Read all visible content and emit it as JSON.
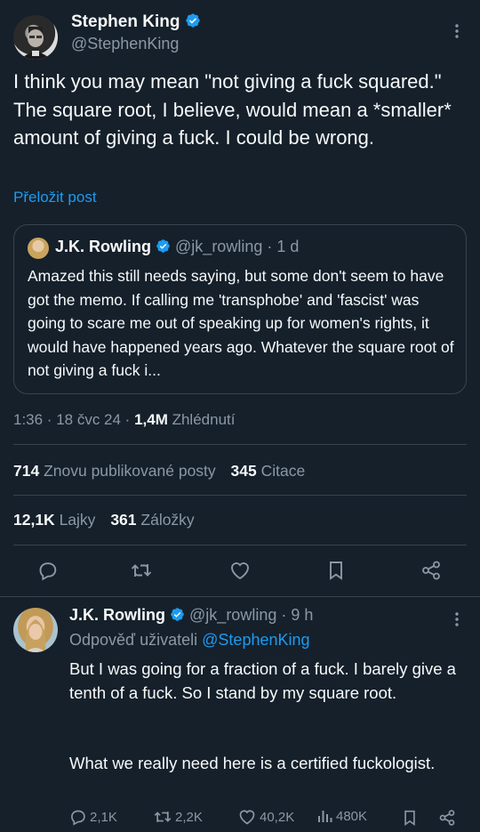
{
  "tweet": {
    "author_name": "Stephen King",
    "author_handle": "@StephenKing",
    "text": "I think you may mean \"not giving a fuck squared.\" The square root, I believe, would mean a *smaller* amount of giving a fuck. I could be wrong.",
    "translate_label": "Přeložit post",
    "quoted": {
      "author_name": "J.K. Rowling",
      "author_handle": "@jk_rowling",
      "time": "· 1 d",
      "text": "Amazed this still needs saying, but some don't seem to have got the memo. If calling me 'transphobe' and 'fascist' was going to scare me out of speaking up for women's rights, it would have happened years ago. Whatever the square root of not giving a fuck i..."
    },
    "meta": {
      "time": "1:36 · 18 čvc 24 · ",
      "views_count": "1,4M",
      "views_label": " Zhlédnutí"
    },
    "stats": {
      "reposts_count": "714",
      "reposts_label": "Znovu publikované posty",
      "quotes_count": "345",
      "quotes_label": "Citace",
      "likes_count": "12,1K",
      "likes_label": "Lajky",
      "bookmarks_count": "361",
      "bookmarks_label": "Záložky"
    }
  },
  "reply": {
    "author_name": "J.K. Rowling",
    "author_handle": "@jk_rowling",
    "time": "· 9 h",
    "replying_prefix": "Odpověď uživateli ",
    "replying_to": "@StephenKing",
    "paragraph1": "But I was going for a fraction of a fuck. I barely give a tenth of a fuck. So I stand by my square root.",
    "paragraph2": "What we really need here is a certified fuckologist.",
    "actions": {
      "replies": "2,1K",
      "reposts": "2,2K",
      "likes": "40,2K",
      "views": "480K"
    }
  },
  "colors": {
    "background": "#15202b",
    "text": "#f7f9f9",
    "muted": "#8b98a5",
    "accent": "#1d9bf0",
    "border": "#38444d"
  }
}
